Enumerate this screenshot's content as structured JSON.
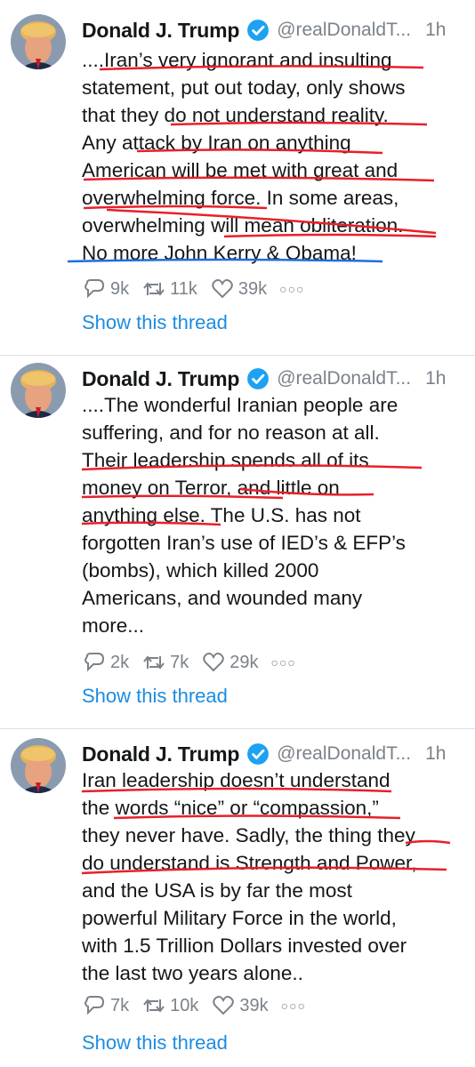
{
  "tweets": [
    {
      "author": "Donald J. Trump",
      "handle": "@realDonaldT...",
      "time": "1h",
      "lines": [
        "....Iran’s very ignorant and insulting",
        "statement, put out today, only shows",
        "that they do not understand reality.",
        "Any attack by Iran on anything",
        "American will be met with great and",
        "overwhelming force. In some areas,",
        "overwhelming will mean obliteration.",
        "No more John Kerry & Obama!"
      ],
      "replies": "9k",
      "retweets": "11k",
      "likes": "39k",
      "show_thread": "Show this thread"
    },
    {
      "author": "Donald J. Trump",
      "handle": "@realDonaldT...",
      "time": "1h",
      "lines": [
        "....The wonderful Iranian people are",
        "suffering, and for no reason at all.",
        "Their leadership spends all of its",
        "money on Terror, and little on",
        "anything else. The U.S. has not",
        "forgotten Iran’s use of IED’s & EFP’s",
        "(bombs), which killed 2000",
        "Americans, and wounded many",
        "more..."
      ],
      "replies": "2k",
      "retweets": "7k",
      "likes": "29k",
      "show_thread": "Show this thread"
    },
    {
      "author": "Donald J. Trump",
      "handle": "@realDonaldT...",
      "time": "1h",
      "lines": [
        "Iran leadership doesn’t understand",
        "the words “nice” or “compassion,”",
        "they never have. Sadly, the thing they",
        "do understand is Strength and Power,",
        "and the USA is by far the most",
        "powerful Military Force in the world,",
        "with 1.5 Trillion Dollars invested over",
        "the last two years alone.."
      ],
      "replies": "7k",
      "retweets": "10k",
      "likes": "39k",
      "show_thread": "Show this thread"
    }
  ],
  "colors": {
    "underline_red": "#e8202a",
    "underline_blue": "#1d6ee0",
    "link": "#1d8ce0",
    "verified": "#1da1f2"
  }
}
